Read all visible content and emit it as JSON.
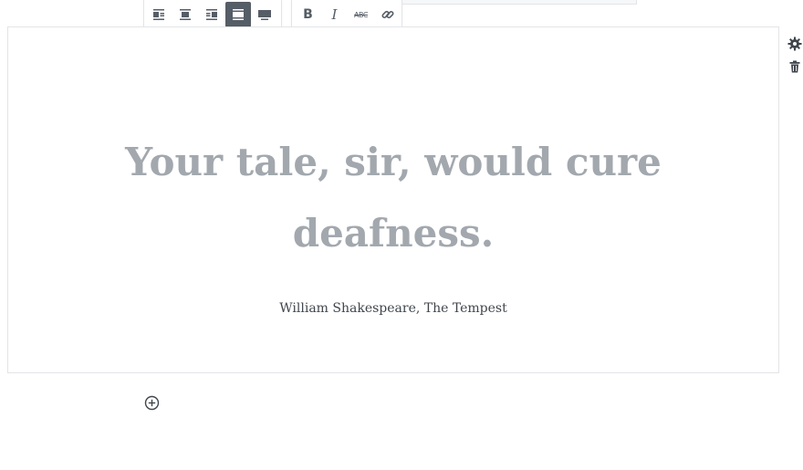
{
  "toolbar": {
    "alignment": [
      {
        "name": "align-left-icon",
        "active": false
      },
      {
        "name": "align-center-icon",
        "active": false
      },
      {
        "name": "align-right-icon",
        "active": false
      },
      {
        "name": "align-wide-icon",
        "active": true
      },
      {
        "name": "align-full-icon",
        "active": false
      }
    ],
    "format": {
      "bold_label": "B",
      "italic_label": "I",
      "strikethrough_label": "ABC",
      "link_icon": "link-icon"
    }
  },
  "block": {
    "quote": "Your tale, sir, would cure deafness.",
    "citation": "William Shakespeare, The Tempest"
  },
  "sidebar_icons": [
    "gear-icon",
    "trash-icon"
  ],
  "inserter_icon": "add-block-icon",
  "colors": {
    "quote_text": "#a2a8ae",
    "citation_text": "#40464d",
    "toolbar_icon": "#555d66",
    "active_button_bg": "#555d66",
    "border": "#e2e4e7"
  }
}
